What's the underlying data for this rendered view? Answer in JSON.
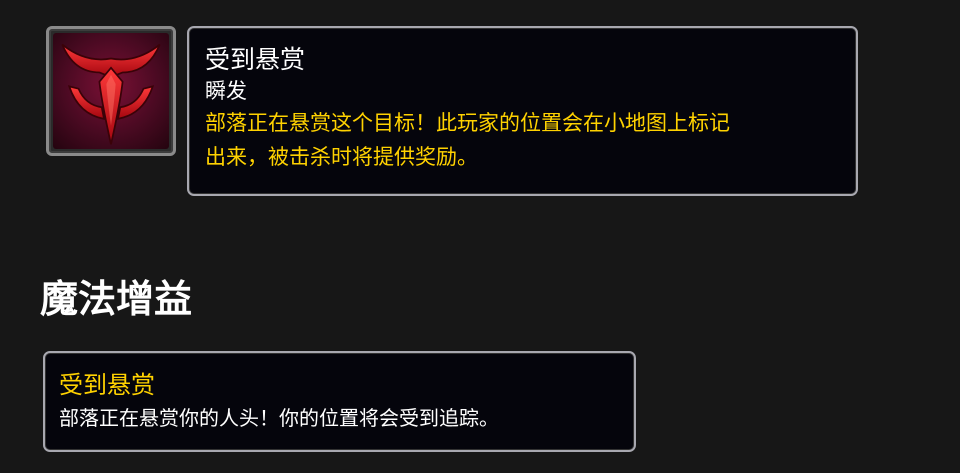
{
  "spell": {
    "icon": "horde-bounty-icon",
    "name": "受到悬赏",
    "cast_time": "瞬发",
    "description_line1": "部落正在悬赏这个目标！此玩家的位置会在小地图上标记",
    "description_line2": "出来，被击杀时将提供奖励。"
  },
  "buffs_section": {
    "heading": "魔法增益",
    "buff": {
      "name": "受到悬赏",
      "description": "部落正在悬赏你的人头！你的位置将会受到追踪。"
    }
  },
  "colors": {
    "background": "#171717",
    "tooltip_bg": "#05050c",
    "tooltip_border": "#a8a8b0",
    "gold_text": "#ffd200",
    "white_text": "#ffffff",
    "icon_red": "#d81420"
  }
}
